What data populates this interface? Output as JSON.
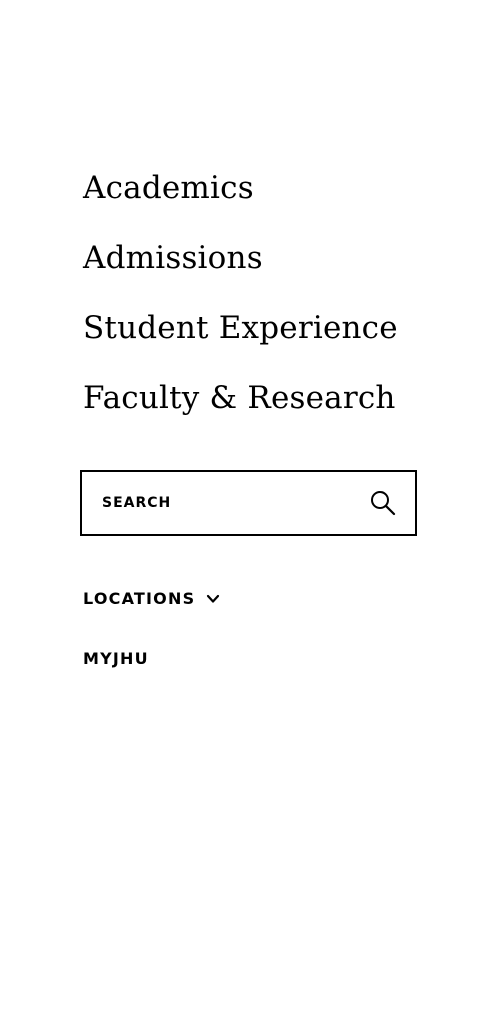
{
  "nav": {
    "items": [
      {
        "label": "Academics"
      },
      {
        "label": "Admissions"
      },
      {
        "label": "Student Experience"
      },
      {
        "label": "Faculty & Research"
      }
    ]
  },
  "search": {
    "placeholder": "SEARCH",
    "icon": "search-icon"
  },
  "utility": {
    "locations_label": "LOCATIONS",
    "locations_icon": "chevron-down-icon",
    "myjhu_label": "MYJHU"
  }
}
